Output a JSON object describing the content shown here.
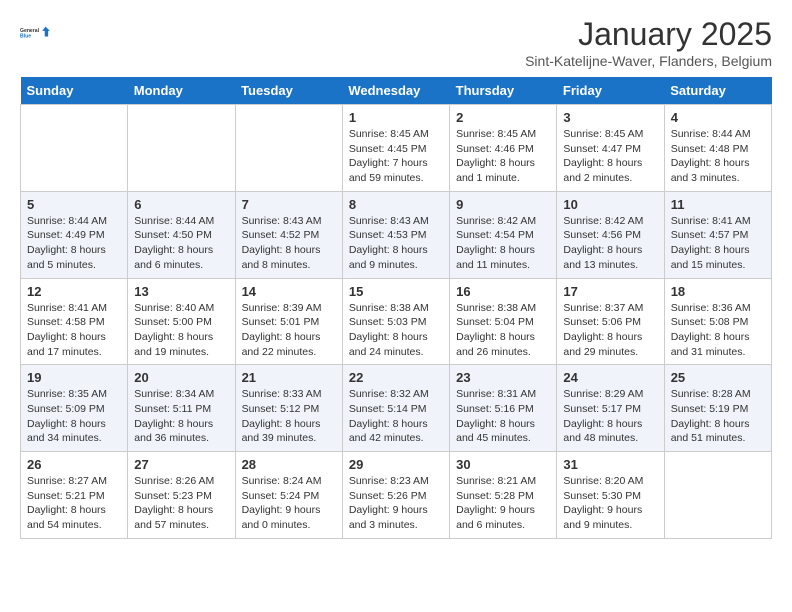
{
  "logo": {
    "line1": "General",
    "line2": "Blue"
  },
  "title": "January 2025",
  "location": "Sint-Katelijne-Waver, Flanders, Belgium",
  "weekdays": [
    "Sunday",
    "Monday",
    "Tuesday",
    "Wednesday",
    "Thursday",
    "Friday",
    "Saturday"
  ],
  "weeks": [
    [
      {
        "day": "",
        "info": ""
      },
      {
        "day": "",
        "info": ""
      },
      {
        "day": "",
        "info": ""
      },
      {
        "day": "1",
        "info": "Sunrise: 8:45 AM\nSunset: 4:45 PM\nDaylight: 7 hours\nand 59 minutes."
      },
      {
        "day": "2",
        "info": "Sunrise: 8:45 AM\nSunset: 4:46 PM\nDaylight: 8 hours\nand 1 minute."
      },
      {
        "day": "3",
        "info": "Sunrise: 8:45 AM\nSunset: 4:47 PM\nDaylight: 8 hours\nand 2 minutes."
      },
      {
        "day": "4",
        "info": "Sunrise: 8:44 AM\nSunset: 4:48 PM\nDaylight: 8 hours\nand 3 minutes."
      }
    ],
    [
      {
        "day": "5",
        "info": "Sunrise: 8:44 AM\nSunset: 4:49 PM\nDaylight: 8 hours\nand 5 minutes."
      },
      {
        "day": "6",
        "info": "Sunrise: 8:44 AM\nSunset: 4:50 PM\nDaylight: 8 hours\nand 6 minutes."
      },
      {
        "day": "7",
        "info": "Sunrise: 8:43 AM\nSunset: 4:52 PM\nDaylight: 8 hours\nand 8 minutes."
      },
      {
        "day": "8",
        "info": "Sunrise: 8:43 AM\nSunset: 4:53 PM\nDaylight: 8 hours\nand 9 minutes."
      },
      {
        "day": "9",
        "info": "Sunrise: 8:42 AM\nSunset: 4:54 PM\nDaylight: 8 hours\nand 11 minutes."
      },
      {
        "day": "10",
        "info": "Sunrise: 8:42 AM\nSunset: 4:56 PM\nDaylight: 8 hours\nand 13 minutes."
      },
      {
        "day": "11",
        "info": "Sunrise: 8:41 AM\nSunset: 4:57 PM\nDaylight: 8 hours\nand 15 minutes."
      }
    ],
    [
      {
        "day": "12",
        "info": "Sunrise: 8:41 AM\nSunset: 4:58 PM\nDaylight: 8 hours\nand 17 minutes."
      },
      {
        "day": "13",
        "info": "Sunrise: 8:40 AM\nSunset: 5:00 PM\nDaylight: 8 hours\nand 19 minutes."
      },
      {
        "day": "14",
        "info": "Sunrise: 8:39 AM\nSunset: 5:01 PM\nDaylight: 8 hours\nand 22 minutes."
      },
      {
        "day": "15",
        "info": "Sunrise: 8:38 AM\nSunset: 5:03 PM\nDaylight: 8 hours\nand 24 minutes."
      },
      {
        "day": "16",
        "info": "Sunrise: 8:38 AM\nSunset: 5:04 PM\nDaylight: 8 hours\nand 26 minutes."
      },
      {
        "day": "17",
        "info": "Sunrise: 8:37 AM\nSunset: 5:06 PM\nDaylight: 8 hours\nand 29 minutes."
      },
      {
        "day": "18",
        "info": "Sunrise: 8:36 AM\nSunset: 5:08 PM\nDaylight: 8 hours\nand 31 minutes."
      }
    ],
    [
      {
        "day": "19",
        "info": "Sunrise: 8:35 AM\nSunset: 5:09 PM\nDaylight: 8 hours\nand 34 minutes."
      },
      {
        "day": "20",
        "info": "Sunrise: 8:34 AM\nSunset: 5:11 PM\nDaylight: 8 hours\nand 36 minutes."
      },
      {
        "day": "21",
        "info": "Sunrise: 8:33 AM\nSunset: 5:12 PM\nDaylight: 8 hours\nand 39 minutes."
      },
      {
        "day": "22",
        "info": "Sunrise: 8:32 AM\nSunset: 5:14 PM\nDaylight: 8 hours\nand 42 minutes."
      },
      {
        "day": "23",
        "info": "Sunrise: 8:31 AM\nSunset: 5:16 PM\nDaylight: 8 hours\nand 45 minutes."
      },
      {
        "day": "24",
        "info": "Sunrise: 8:29 AM\nSunset: 5:17 PM\nDaylight: 8 hours\nand 48 minutes."
      },
      {
        "day": "25",
        "info": "Sunrise: 8:28 AM\nSunset: 5:19 PM\nDaylight: 8 hours\nand 51 minutes."
      }
    ],
    [
      {
        "day": "26",
        "info": "Sunrise: 8:27 AM\nSunset: 5:21 PM\nDaylight: 8 hours\nand 54 minutes."
      },
      {
        "day": "27",
        "info": "Sunrise: 8:26 AM\nSunset: 5:23 PM\nDaylight: 8 hours\nand 57 minutes."
      },
      {
        "day": "28",
        "info": "Sunrise: 8:24 AM\nSunset: 5:24 PM\nDaylight: 9 hours\nand 0 minutes."
      },
      {
        "day": "29",
        "info": "Sunrise: 8:23 AM\nSunset: 5:26 PM\nDaylight: 9 hours\nand 3 minutes."
      },
      {
        "day": "30",
        "info": "Sunrise: 8:21 AM\nSunset: 5:28 PM\nDaylight: 9 hours\nand 6 minutes."
      },
      {
        "day": "31",
        "info": "Sunrise: 8:20 AM\nSunset: 5:30 PM\nDaylight: 9 hours\nand 9 minutes."
      },
      {
        "day": "",
        "info": ""
      }
    ]
  ]
}
